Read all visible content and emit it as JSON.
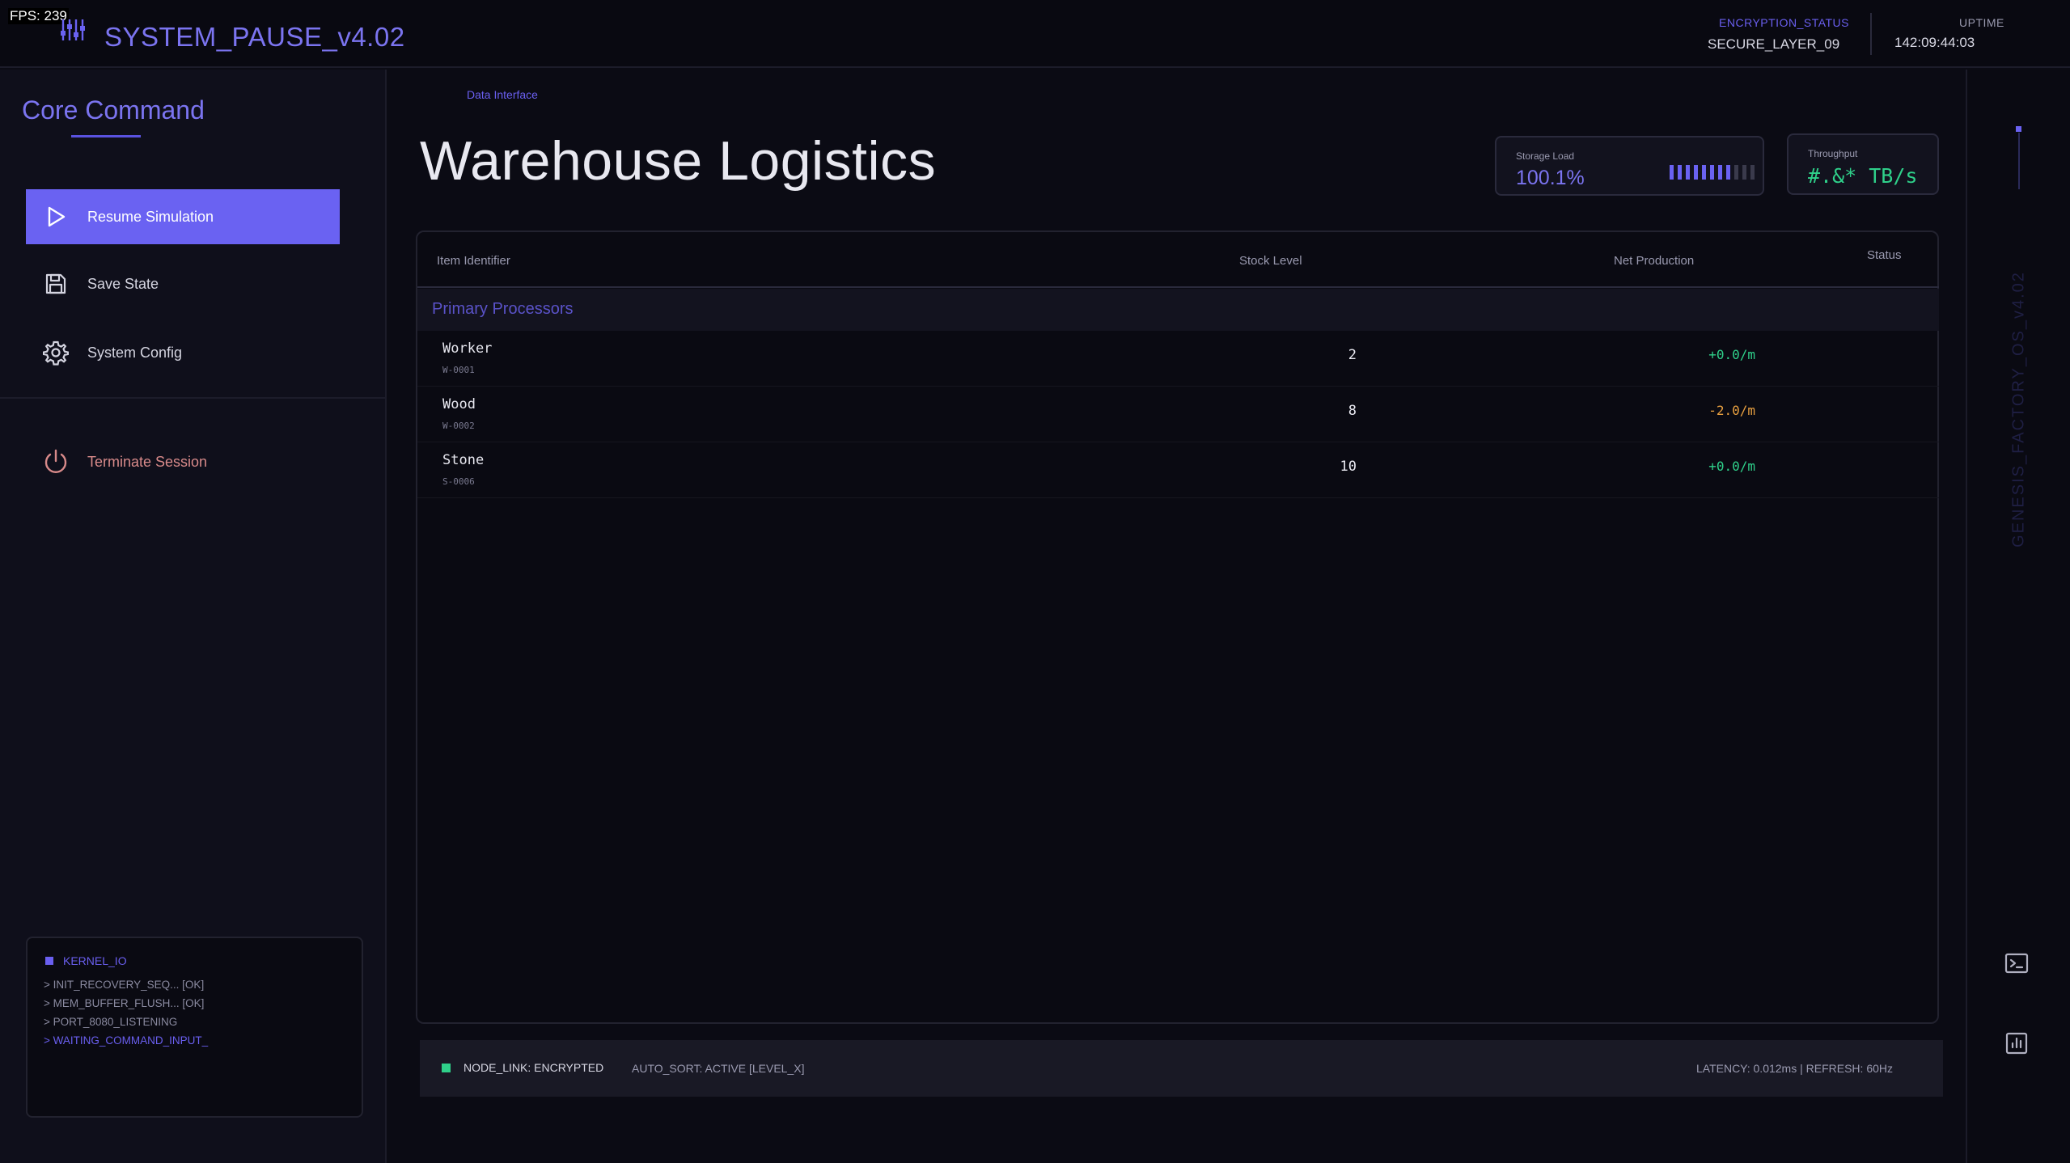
{
  "fps": "FPS: 239",
  "app": {
    "title": "SYSTEM_PAUSE_v4.02",
    "logo_icon": "equalizer-icon"
  },
  "header": {
    "encryption_label": "ENCRYPTION_STATUS",
    "encryption_value": "SECURE_LAYER_09",
    "uptime_label": "UPTIME",
    "uptime_value": "142:09:44:03"
  },
  "sidebar": {
    "title": "Core Command",
    "items": [
      {
        "label": "Resume Simulation",
        "icon": "play-icon",
        "active": true
      },
      {
        "label": "Save State",
        "icon": "save-icon"
      },
      {
        "label": "System Config",
        "icon": "gear-icon"
      },
      {
        "label": "Terminate Session",
        "icon": "power-icon",
        "danger": true
      }
    ],
    "kernel": {
      "title": "KERNEL_IO",
      "lines": [
        "> INIT_RECOVERY_SEQ... [OK]",
        "> MEM_BUFFER_FLUSH... [OK]",
        "> PORT_8080_LISTENING",
        "> WAITING_COMMAND_INPUT_"
      ]
    }
  },
  "main": {
    "breadcrumb": "Data Interface",
    "title": "Warehouse Logistics",
    "stats": {
      "storage": {
        "label": "Storage Load",
        "value": "100.1%",
        "bars_on": 8,
        "bars_total": 11
      },
      "throughput": {
        "label": "Throughput",
        "value": "#.&* TB/s"
      }
    },
    "table": {
      "columns": [
        "Item Identifier",
        "Stock Level",
        "Net Production",
        "Status"
      ],
      "group": "Primary Processors",
      "rows": [
        {
          "name": "Worker",
          "code": "W-0001",
          "stock": "2",
          "net": "+0.0/m",
          "trend": "pos"
        },
        {
          "name": "Wood",
          "code": "W-0002",
          "stock": "8",
          "net": "-2.0/m",
          "trend": "neg"
        },
        {
          "name": "Stone",
          "code": "S-0006",
          "stock": "10",
          "net": "+0.0/m",
          "trend": "pos"
        }
      ]
    },
    "statusbar": {
      "link": "NODE_LINK: ENCRYPTED",
      "sort": "AUTO_SORT: ACTIVE [LEVEL_X]",
      "latency": "LATENCY: 0.012ms | REFRESH: 60Hz"
    }
  },
  "rail": {
    "vertical_text": "GENESIS_FACTORY_OS_v4.02",
    "icons": [
      "terminal-icon",
      "chart-icon"
    ]
  },
  "colors": {
    "accent": "#6a62f2",
    "positive": "#2fd08a",
    "negative": "#e8a040",
    "danger": "#d88a8a"
  }
}
